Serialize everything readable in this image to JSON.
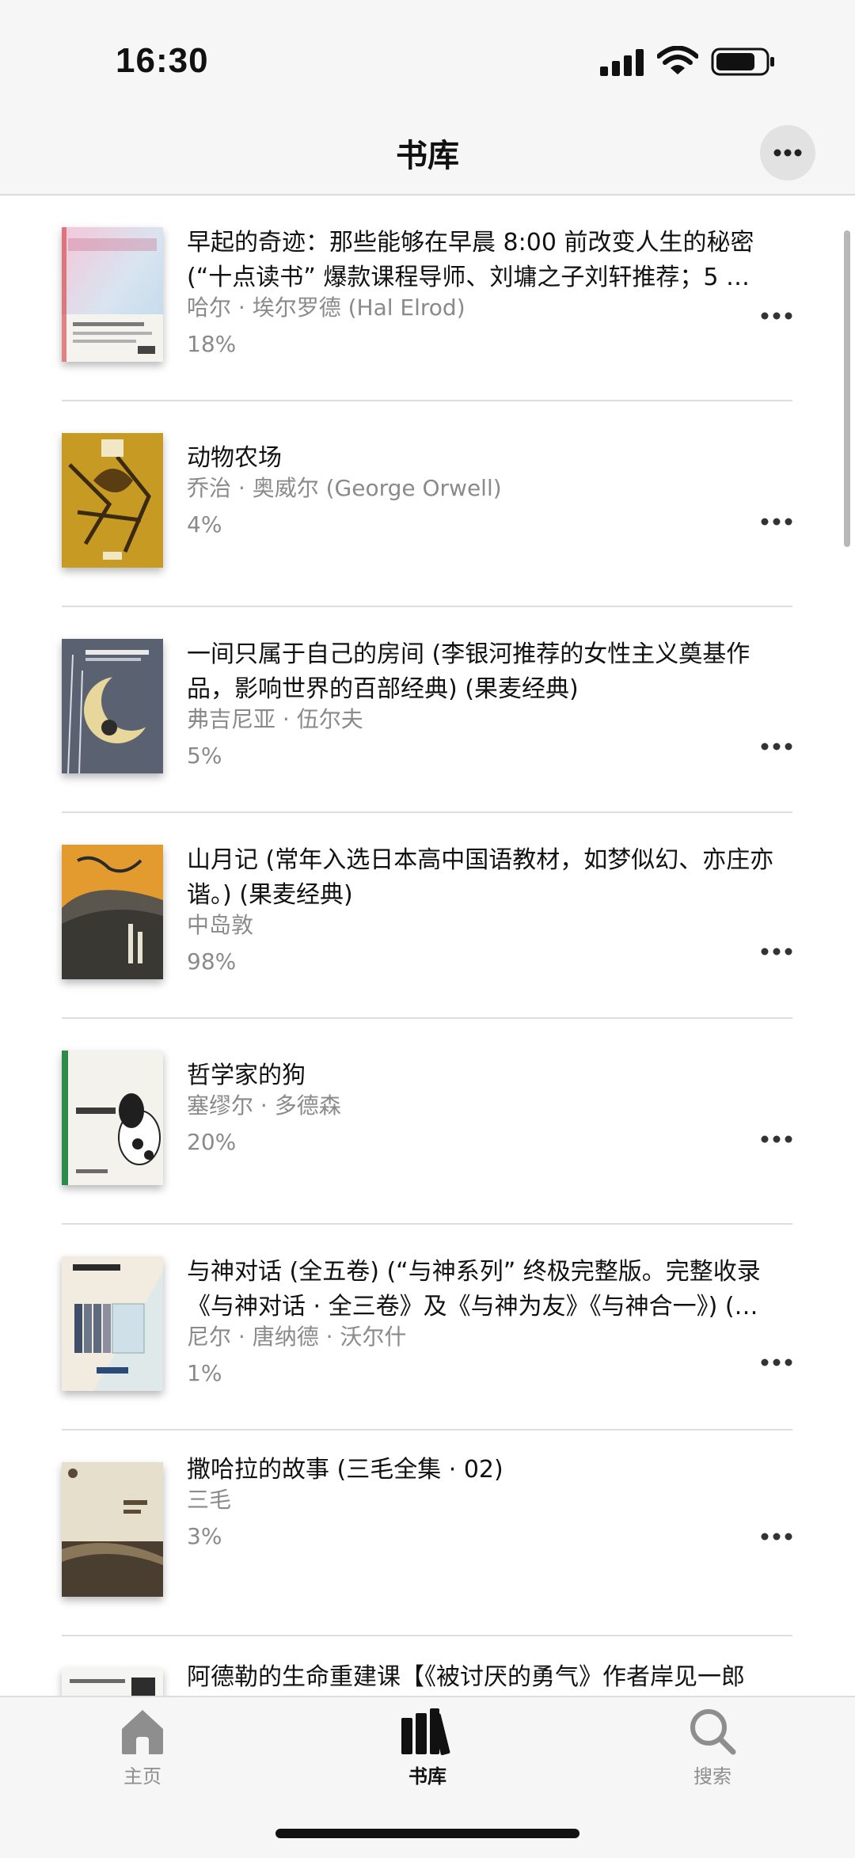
{
  "status_bar": {
    "time": "16:30"
  },
  "header": {
    "title": "书库"
  },
  "books": [
    {
      "title": "早起的奇迹：那些能够在早晨 8:00 前改变人生的秘密 (“十点读书” 爆款课程导师、刘墉之子刘轩推荐；5 …",
      "author": "哈尔 · 埃尔罗德 (Hal Elrod)",
      "progress": "18%"
    },
    {
      "title": "动物农场",
      "author": "乔治 · 奥威尔 (George Orwell)",
      "progress": "4%"
    },
    {
      "title": "一间只属于自己的房间 (李银河推荐的女性主义奠基作品，影响世界的百部经典) (果麦经典)",
      "author": "弗吉尼亚 · 伍尔夫",
      "progress": "5%"
    },
    {
      "title": "山月记 (常年入选日本高中国语教材，如梦似幻、亦庄亦谐。) (果麦经典)",
      "author": "中岛敦",
      "progress": "98%"
    },
    {
      "title": "哲学家的狗",
      "author": "塞缪尔 · 多德森",
      "progress": "20%"
    },
    {
      "title": "与神对话 (全五卷) (“与神系列” 终极完整版。完整收录《与神对话 · 全三卷》及《与神为友》《与神合一》) (…",
      "author": "尼尔 · 唐纳德 · 沃尔什",
      "progress": "1%"
    },
    {
      "title": "撒哈拉的故事 (三毛全集 · 02)",
      "author": "三毛",
      "progress": "3%"
    },
    {
      "title": "阿德勒的生命重建课【《被讨厌的勇气》作者岸见一郎",
      "author": "",
      "progress": ""
    }
  ],
  "tab_bar": {
    "tabs": [
      {
        "label": "主页",
        "icon": "home-icon"
      },
      {
        "label": "书库",
        "icon": "library-icon"
      },
      {
        "label": "搜索",
        "icon": "search-icon"
      }
    ],
    "active": "书库"
  },
  "colors": {
    "background": "#ffffff",
    "bar": "#f6f6f6",
    "secondary_text": "#8a8a8a",
    "divider": "#dedede"
  }
}
